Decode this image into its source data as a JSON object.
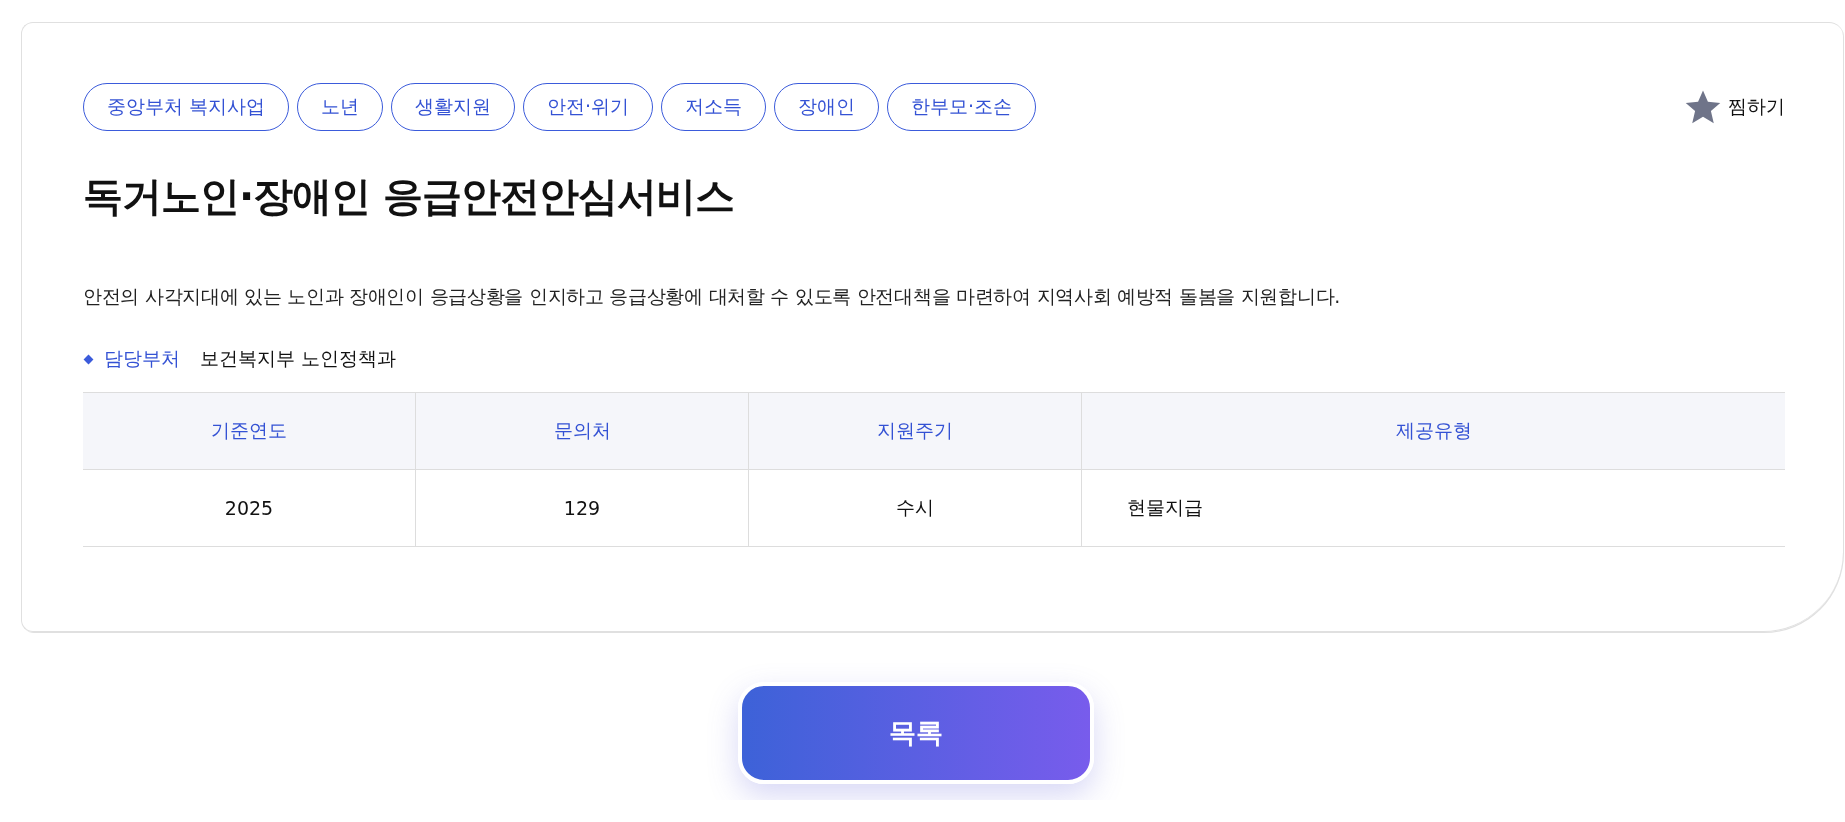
{
  "tags": [
    "중앙부처 복지사업",
    "노년",
    "생활지원",
    "안전·위기",
    "저소득",
    "장애인",
    "한부모·조손"
  ],
  "favorite": {
    "label": "찜하기",
    "selected": false
  },
  "title": "독거노인·장애인 응급안전안심서비스",
  "description": "안전의 사각지대에 있는 노인과 장애인이 응급상황을 인지하고 응급상황에 대처할 수 있도록 안전대책을 마련하여 지역사회 예방적 돌봄을 지원합니다.",
  "department": {
    "label": "담당부처",
    "value": "보건복지부 노인정책과"
  },
  "table": {
    "columns": [
      "기준연도",
      "문의처",
      "지원주기",
      "제공유형"
    ],
    "rows": [
      [
        "2025",
        "129",
        "수시",
        "현물지급"
      ]
    ]
  },
  "list_button": "목록"
}
